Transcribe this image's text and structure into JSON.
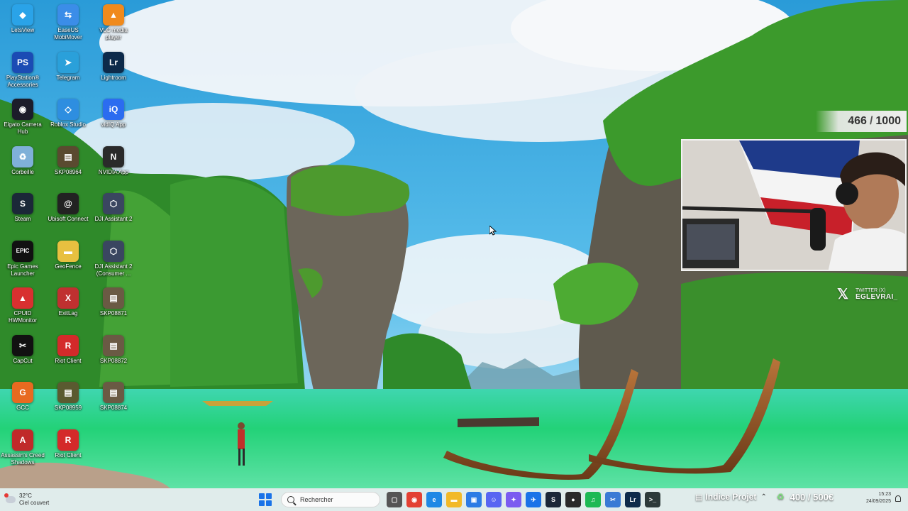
{
  "desktop": {
    "icons": [
      {
        "label": "LetsView",
        "glyph": "◆",
        "color": "#2aa3e8"
      },
      {
        "label": "EaseUS MobiMover",
        "glyph": "⇆",
        "color": "#3b8de8"
      },
      {
        "label": "VLC media player",
        "glyph": "▲",
        "color": "#f08a1c"
      },
      {
        "label": "PlayStation® Accessories",
        "glyph": "PS",
        "color": "#1b4bb4"
      },
      {
        "label": "Telegram",
        "glyph": "➤",
        "color": "#2aa0da"
      },
      {
        "label": "Lightroom",
        "glyph": "Lr",
        "color": "#0d2a4a"
      },
      {
        "label": "Elgato Camera Hub",
        "glyph": "◉",
        "color": "#1c1c2a"
      },
      {
        "label": "Roblox Studio",
        "glyph": "◇",
        "color": "#2e8ee0"
      },
      {
        "label": "vidIQ App",
        "glyph": "iQ",
        "color": "#2b6cf0"
      },
      {
        "label": "Corbeille",
        "glyph": "♻",
        "color": "#7fb0d8"
      },
      {
        "label": "SKP08964",
        "glyph": "▤",
        "color": "#5a4a30"
      },
      {
        "label": "NVIDIA App",
        "glyph": "N",
        "color": "#2a2a2a"
      },
      {
        "label": "Steam",
        "glyph": "S",
        "color": "#1b2838"
      },
      {
        "label": "Ubisoft Connect",
        "glyph": "@",
        "color": "#222"
      },
      {
        "label": "DJI Assistant 2",
        "glyph": "⬡",
        "color": "#3a4660"
      },
      {
        "label": "Epic Games Launcher",
        "glyph": "EPIC",
        "color": "#111"
      },
      {
        "label": "GeoFence",
        "glyph": "▬",
        "color": "#e8c040"
      },
      {
        "label": "DJI Assistant 2 (Consumer ...",
        "glyph": "⬡",
        "color": "#3a4660"
      },
      {
        "label": "CPUID HWMonitor",
        "glyph": "▲",
        "color": "#d83030"
      },
      {
        "label": "ExitLag",
        "glyph": "X",
        "color": "#c03030"
      },
      {
        "label": "SKP08871",
        "glyph": "▤",
        "color": "#6a5a44"
      },
      {
        "label": "CapCut",
        "glyph": "✂",
        "color": "#111"
      },
      {
        "label": "Riot Client",
        "glyph": "R",
        "color": "#d42a2a"
      },
      {
        "label": "SKP08872",
        "glyph": "▤",
        "color": "#6a5a44"
      },
      {
        "label": "GCC",
        "glyph": "G",
        "color": "#e86a20"
      },
      {
        "label": "SKP08959",
        "glyph": "▤",
        "color": "#5a5a30"
      },
      {
        "label": "SKP08874",
        "glyph": "▤",
        "color": "#6a5a44"
      },
      {
        "label": "Assassin's Creed Shadows",
        "glyph": "A",
        "color": "#c02a2a"
      },
      {
        "label": "Riot Client",
        "glyph": "R",
        "color": "#d42a2a"
      }
    ]
  },
  "overlay": {
    "counter_current": "466",
    "counter_sep": "/",
    "counter_total": "1000",
    "twitter_label": "TWITTER (X)",
    "twitter_handle": "EGLEVRAI_",
    "project_label": "Indice Projet",
    "budget": "400 / 500€"
  },
  "taskbar": {
    "weather_temp": "32°C",
    "weather_cond": "Ciel couvert",
    "search_placeholder": "Rechercher",
    "apps": [
      {
        "name": "task-view-icon",
        "glyph": "▢",
        "color": "#555"
      },
      {
        "name": "chrome-icon",
        "glyph": "◉",
        "color": "#e34133"
      },
      {
        "name": "edge-icon",
        "glyph": "e",
        "color": "#1e88e5"
      },
      {
        "name": "file-explorer-icon",
        "glyph": "▬",
        "color": "#f2b928"
      },
      {
        "name": "photos-icon",
        "glyph": "▣",
        "color": "#2c7be5"
      },
      {
        "name": "discord-icon",
        "glyph": "☺",
        "color": "#5865f2"
      },
      {
        "name": "copilot-icon",
        "glyph": "✦",
        "color": "#7b5cf0"
      },
      {
        "name": "vpn-icon",
        "glyph": "✈",
        "color": "#1a73e8"
      },
      {
        "name": "steam-icon",
        "glyph": "S",
        "color": "#1b2838"
      },
      {
        "name": "obs-icon",
        "glyph": "●",
        "color": "#2a2a2a"
      },
      {
        "name": "spotify-icon",
        "glyph": "♫",
        "color": "#1db954"
      },
      {
        "name": "snipping-tool-icon",
        "glyph": "✂",
        "color": "#3a7bd5"
      },
      {
        "name": "lightroom-icon",
        "glyph": "Lr",
        "color": "#0d2a4a"
      },
      {
        "name": "terminal-icon",
        "glyph": ">_",
        "color": "#2d3a3a"
      }
    ],
    "time": "15:23",
    "date": "24/09/2025"
  }
}
